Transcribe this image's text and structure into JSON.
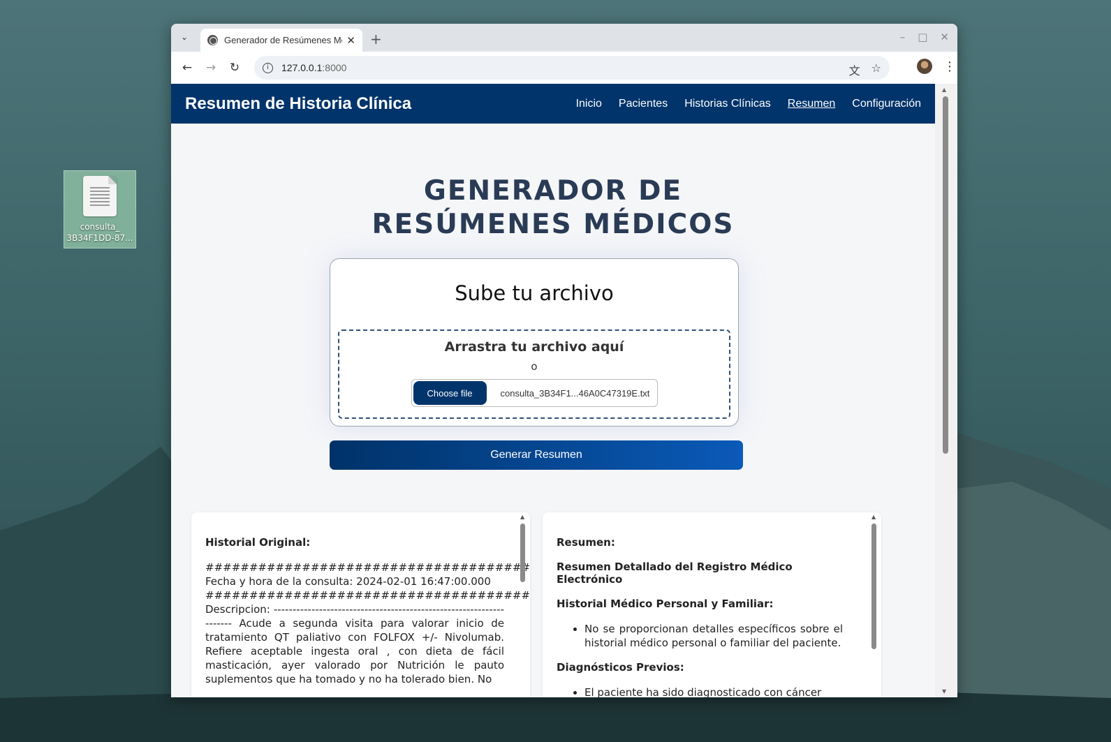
{
  "desktop": {
    "file_icon_label_line1": "consulta_",
    "file_icon_label_line2": "3B34F1DD-87..."
  },
  "browser": {
    "tab_title": "Generador de Resúmenes Médicos",
    "url_host": "127.0.0.1",
    "url_port": ":8000"
  },
  "site": {
    "title": "Resumen de Historia Clínica",
    "nav": [
      "Inicio",
      "Pacientes",
      "Historias Clínicas",
      "Resumen",
      "Configuración"
    ],
    "active_nav": "Resumen"
  },
  "main": {
    "title_line1": "GENERADOR DE",
    "title_line2": "RESÚMENES MÉDICOS"
  },
  "upload": {
    "heading": "Sube tu archivo",
    "drop_text": "Arrastra tu archivo aquí",
    "or_text": "o",
    "choose_label": "Choose file",
    "file_name": "consulta_3B34F1...46A0C47319E.txt",
    "generate_label": "Generar Resumen"
  },
  "original": {
    "heading": "Historial Original:",
    "text": "##############################################\nFecha y hora de la consulta: 2024-02-01 16:47:00.000\n##############################################\nDescripcion: -------------------------------------------------------------------- Acude a segunda visita para valorar inicio de tratamiento QT paliativo con FOLFOX +/- Nivolumab. Refiere aceptable ingesta oral , con dieta de fácil masticación, ayer valorado por Nutrición le pauto suplementos que ha tomado y no ha tolerado bien. No"
  },
  "summary": {
    "heading": "Resumen:",
    "subtitle": "Resumen Detallado del Registro Médico Electrónico",
    "section1_title": "Historial Médico Personal y Familiar:",
    "section1_item": "No se proporcionan detalles específicos sobre el historial médico personal o familiar del paciente.",
    "section2_title": "Diagnósticos Previos:",
    "section2_item": "El paciente ha sido diagnosticado con cáncer"
  }
}
